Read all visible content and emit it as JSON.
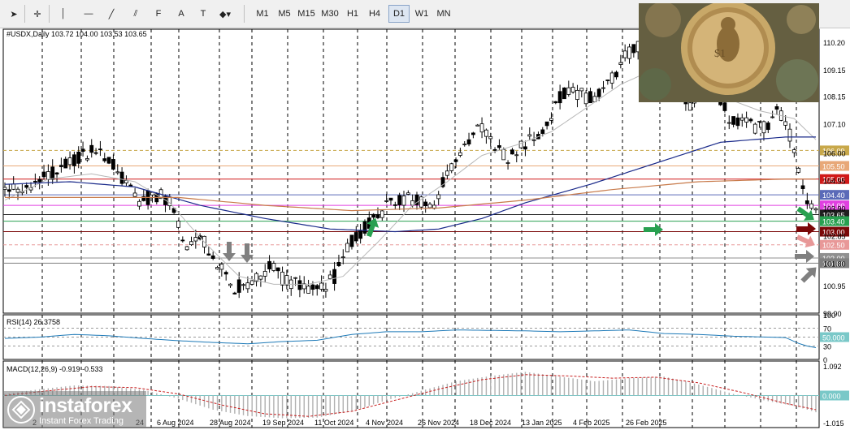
{
  "toolbar": {
    "tools": [
      {
        "name": "cursor-icon",
        "glyph": "➤"
      },
      {
        "name": "crosshair-icon",
        "glyph": "✛"
      },
      {
        "name": "vertical-line-icon",
        "glyph": "│"
      },
      {
        "name": "horizontal-line-icon",
        "glyph": "—"
      },
      {
        "name": "trendline-icon",
        "glyph": "╱"
      },
      {
        "name": "channel-icon",
        "glyph": "⫽"
      },
      {
        "name": "fibonacci-icon",
        "glyph": "F"
      },
      {
        "name": "text-icon",
        "glyph": "A"
      },
      {
        "name": "text-label-icon",
        "glyph": "T"
      },
      {
        "name": "shapes-dropdown-icon",
        "glyph": "◆▾"
      }
    ],
    "timeframes": [
      "M1",
      "M5",
      "M15",
      "M30",
      "H1",
      "H4",
      "D1",
      "W1",
      "MN"
    ],
    "active_timeframe": "D1"
  },
  "chart_data": [
    {
      "type": "candlestick",
      "title": "#USDX,Daily  103.72 104.00 103.53 103.65",
      "ylim": [
        99.9,
        110.7
      ],
      "price_ticks": [
        "110.20",
        "109.15",
        "108.15",
        "107.10",
        "106.00",
        "104.95",
        "103.90",
        "102.85",
        "101.80",
        "100.95",
        "99.90"
      ],
      "x_tick_labels": [
        "6 Aug 2024",
        "28 Aug 2024",
        "19 Sep 2024",
        "11 Oct 2024",
        "4 Nov 2024",
        "26 Nov 2024",
        "18 Dec 2024",
        "13 Jan 2025",
        "4 Feb 2025",
        "26 Feb 2025"
      ],
      "x_label_fragment": "2",
      "x_label_fragment_2": "24",
      "levels": [
        {
          "label": "106.09",
          "value": 106.09,
          "color": "#c8a84a"
        },
        {
          "label": "105.50",
          "value": 105.5,
          "color": "#e8a878"
        },
        {
          "label": "105.00",
          "value": 105.0,
          "color": "#d01818"
        },
        {
          "label": "104.40",
          "value": 104.4,
          "color": "#5a6ab8"
        },
        {
          "label": "104.00",
          "value": 104.0,
          "color": "#e040e0"
        },
        {
          "label": "103.65",
          "value": 103.65,
          "color": "#202020"
        },
        {
          "label": "103.40",
          "value": 103.4,
          "color": "#28a050"
        },
        {
          "label": "103.00",
          "value": 103.0,
          "color": "#7a0808"
        },
        {
          "label": "102.50",
          "value": 102.5,
          "color": "#e89898"
        },
        {
          "label": "102.00",
          "value": 102.0,
          "color": "#909090"
        },
        {
          "label": "101.80",
          "value": 101.8,
          "color": "#808080"
        }
      ],
      "price_path": [
        [
          0,
          104.6
        ],
        [
          4,
          104.7
        ],
        [
          8,
          104.9
        ],
        [
          13,
          105.4
        ],
        [
          17,
          105.8
        ],
        [
          21,
          106.1
        ],
        [
          24,
          105.7
        ],
        [
          27,
          105.1
        ],
        [
          30,
          104.2
        ],
        [
          33,
          104.3
        ],
        [
          36,
          104.4
        ],
        [
          38,
          104.1
        ],
        [
          40,
          103.3
        ],
        [
          42,
          102.5
        ],
        [
          45,
          102.9
        ],
        [
          48,
          102.1
        ],
        [
          51,
          101.2
        ],
        [
          53,
          100.9
        ],
        [
          56,
          101.0
        ],
        [
          59,
          101.4
        ],
        [
          62,
          101.7
        ],
        [
          64,
          101.2
        ],
        [
          67,
          101.0
        ],
        [
          70,
          100.9
        ],
        [
          73,
          100.8
        ],
        [
          76,
          101.3
        ],
        [
          79,
          102.4
        ],
        [
          82,
          103.0
        ],
        [
          85,
          103.4
        ],
        [
          88,
          104.0
        ],
        [
          91,
          104.2
        ],
        [
          94,
          104.2
        ],
        [
          97,
          104.2
        ],
        [
          99,
          103.8
        ],
        [
          101,
          104.9
        ],
        [
          104,
          105.8
        ],
        [
          107,
          106.5
        ],
        [
          110,
          107.0
        ],
        [
          113,
          106.2
        ],
        [
          116,
          105.8
        ],
        [
          119,
          106.2
        ],
        [
          122,
          106.6
        ],
        [
          125,
          107.2
        ],
        [
          128,
          108.1
        ],
        [
          131,
          108.4
        ],
        [
          134,
          108.1
        ],
        [
          137,
          108.2
        ],
        [
          140,
          108.9
        ],
        [
          143,
          109.6
        ],
        [
          146,
          110.1
        ],
        [
          149,
          109.4
        ],
        [
          152,
          108.9
        ],
        [
          155,
          108.4
        ],
        [
          158,
          107.7
        ],
        [
          160,
          108.1
        ],
        [
          162,
          108.3
        ],
        [
          165,
          108.0
        ],
        [
          167,
          107.3
        ],
        [
          170,
          107.3
        ],
        [
          173,
          106.9
        ],
        [
          176,
          107.1
        ],
        [
          178,
          107.6
        ],
        [
          180,
          107.2
        ],
        [
          182,
          106.2
        ],
        [
          184,
          104.6
        ],
        [
          186,
          103.9
        ],
        [
          187,
          103.65
        ]
      ],
      "ma_fast": [
        [
          0,
          104.2
        ],
        [
          10,
          105.0
        ],
        [
          20,
          105.2
        ],
        [
          30,
          104.9
        ],
        [
          38,
          104.1
        ],
        [
          46,
          102.6
        ],
        [
          54,
          101.3
        ],
        [
          62,
          101.0
        ],
        [
          70,
          101.0
        ],
        [
          78,
          101.3
        ],
        [
          86,
          102.6
        ],
        [
          94,
          104.0
        ],
        [
          102,
          104.9
        ],
        [
          110,
          105.9
        ],
        [
          118,
          106.3
        ],
        [
          126,
          106.8
        ],
        [
          134,
          107.7
        ],
        [
          142,
          108.6
        ],
        [
          150,
          109.2
        ],
        [
          158,
          108.7
        ],
        [
          166,
          108.1
        ],
        [
          174,
          107.6
        ],
        [
          182,
          107.3
        ],
        [
          187,
          106.5
        ]
      ],
      "ma_mid": [
        [
          0,
          104.8
        ],
        [
          15,
          104.9
        ],
        [
          30,
          104.7
        ],
        [
          45,
          104.0
        ],
        [
          60,
          103.5
        ],
        [
          75,
          103.1
        ],
        [
          90,
          103.0
        ],
        [
          100,
          103.1
        ],
        [
          110,
          103.5
        ],
        [
          120,
          104.1
        ],
        [
          135,
          104.8
        ],
        [
          150,
          105.6
        ],
        [
          165,
          106.4
        ],
        [
          180,
          106.6
        ],
        [
          187,
          106.6
        ]
      ],
      "ma_slow": [
        [
          0,
          104.3
        ],
        [
          20,
          104.3
        ],
        [
          40,
          104.3
        ],
        [
          60,
          104.0
        ],
        [
          80,
          103.8
        ],
        [
          100,
          103.9
        ],
        [
          120,
          104.2
        ],
        [
          140,
          104.6
        ],
        [
          160,
          104.9
        ],
        [
          180,
          105.0
        ],
        [
          187,
          105.0
        ]
      ]
    },
    {
      "type": "line",
      "title": "RSI(14) 26.3758",
      "ylim": [
        0,
        100
      ],
      "ticks": [
        "100",
        "70",
        "50",
        "30",
        "0"
      ],
      "level_badge": "50.000",
      "values": [
        [
          0,
          47
        ],
        [
          8,
          50
        ],
        [
          16,
          56
        ],
        [
          24,
          53
        ],
        [
          32,
          47
        ],
        [
          40,
          42
        ],
        [
          48,
          38
        ],
        [
          56,
          35
        ],
        [
          64,
          40
        ],
        [
          72,
          43
        ],
        [
          80,
          56
        ],
        [
          88,
          62
        ],
        [
          96,
          62
        ],
        [
          104,
          66
        ],
        [
          112,
          65
        ],
        [
          120,
          64
        ],
        [
          128,
          62
        ],
        [
          136,
          64
        ],
        [
          144,
          66
        ],
        [
          152,
          58
        ],
        [
          160,
          56
        ],
        [
          168,
          52
        ],
        [
          176,
          50
        ],
        [
          180,
          49
        ],
        [
          183,
          36
        ],
        [
          185,
          30
        ],
        [
          187,
          26.4
        ]
      ]
    },
    {
      "type": "bar",
      "title": "MACD(12,26,9) -0.919 -0.533",
      "ylim": [
        -1.015,
        1.092
      ],
      "ticks": [
        "1.092",
        "0.000",
        "-1.015"
      ],
      "level_badge": "0.000",
      "values": [
        [
          0,
          0.05
        ],
        [
          8,
          0.2
        ],
        [
          16,
          0.32
        ],
        [
          24,
          0.3
        ],
        [
          32,
          0.18
        ],
        [
          40,
          -0.1
        ],
        [
          48,
          -0.45
        ],
        [
          56,
          -0.65
        ],
        [
          64,
          -0.72
        ],
        [
          72,
          -0.7
        ],
        [
          80,
          -0.5
        ],
        [
          88,
          -0.15
        ],
        [
          96,
          0.15
        ],
        [
          104,
          0.45
        ],
        [
          112,
          0.62
        ],
        [
          120,
          0.75
        ],
        [
          128,
          0.6
        ],
        [
          136,
          0.45
        ],
        [
          144,
          0.55
        ],
        [
          152,
          0.6
        ],
        [
          160,
          0.35
        ],
        [
          168,
          0.05
        ],
        [
          176,
          -0.18
        ],
        [
          182,
          -0.33
        ],
        [
          187,
          -0.53
        ]
      ],
      "signal": [
        [
          0,
          0.0
        ],
        [
          10,
          0.15
        ],
        [
          20,
          0.28
        ],
        [
          30,
          0.25
        ],
        [
          40,
          0.05
        ],
        [
          50,
          -0.3
        ],
        [
          60,
          -0.58
        ],
        [
          70,
          -0.66
        ],
        [
          80,
          -0.5
        ],
        [
          90,
          -0.15
        ],
        [
          100,
          0.2
        ],
        [
          110,
          0.5
        ],
        [
          120,
          0.66
        ],
        [
          130,
          0.62
        ],
        [
          140,
          0.55
        ],
        [
          150,
          0.58
        ],
        [
          160,
          0.4
        ],
        [
          170,
          0.1
        ],
        [
          180,
          -0.25
        ],
        [
          187,
          -0.45
        ]
      ]
    }
  ],
  "logo": {
    "name": "instaforex",
    "tagline": "Instant Forex Trading"
  }
}
